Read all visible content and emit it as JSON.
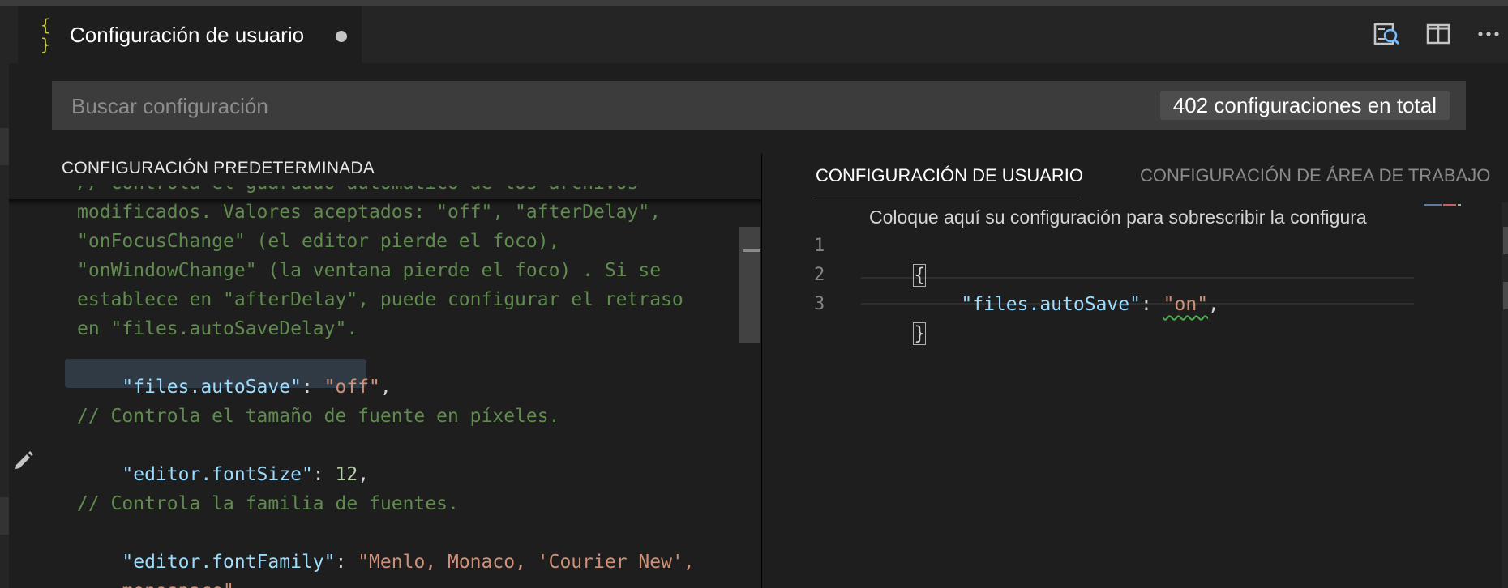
{
  "tab": {
    "icon": "{ }",
    "title": "Configuración de usuario"
  },
  "actions": {
    "open_settings_icon": "open-settings-icon",
    "split_icon": "split-editor-icon",
    "more_icon": "more-icon"
  },
  "search": {
    "placeholder": "Buscar configuración",
    "value": "",
    "count": "402 configuraciones en total"
  },
  "left": {
    "header": "CONFIGURACIÓN PREDETERMINADA",
    "lines": [
      {
        "comment": "// Controla el guardado automático de los archivos"
      },
      {
        "comment": "modificados. Valores aceptados: \"off\", \"afterDelay\","
      },
      {
        "comment": "\"onFocusChange\" (el editor pierde el foco),"
      },
      {
        "comment": "\"onWindowChange\" (la ventana pierde el foco) . Si se"
      },
      {
        "comment": "establece en \"afterDelay\", puede configurar el retraso"
      },
      {
        "comment": "en \"files.autoSaveDelay\"."
      },
      {
        "key": "\"files.autoSave\"",
        "sep": ": ",
        "value": "\"off\"",
        "end": ","
      },
      {
        "comment": ""
      },
      {
        "comment": "// Controla el tamaño de fuente en píxeles."
      },
      {
        "key": "\"editor.fontSize\"",
        "sep": ": ",
        "num": "12",
        "end": ","
      },
      {
        "comment": ""
      },
      {
        "comment": "// Controla la familia de fuentes."
      },
      {
        "key": "\"editor.fontFamily\"",
        "sep": ": ",
        "value": "\"Menlo, Monaco, 'Courier New',",
        "end": ""
      },
      {
        "value_cont": "monospace\"",
        "end": ","
      }
    ]
  },
  "right": {
    "tab_user": "CONFIGURACIÓN DE USUARIO",
    "tab_workspace": "CONFIGURACIÓN DE ÁREA DE TRABAJO",
    "hint": "Coloque aquí su configuración para sobrescribir la configura",
    "line_numbers": [
      "1",
      "2",
      "3"
    ],
    "open_brace": "{",
    "key": "\"files.autoSave\"",
    "sep": ": ",
    "value": "\"on\"",
    "end": ",",
    "close_brace": "}"
  }
}
